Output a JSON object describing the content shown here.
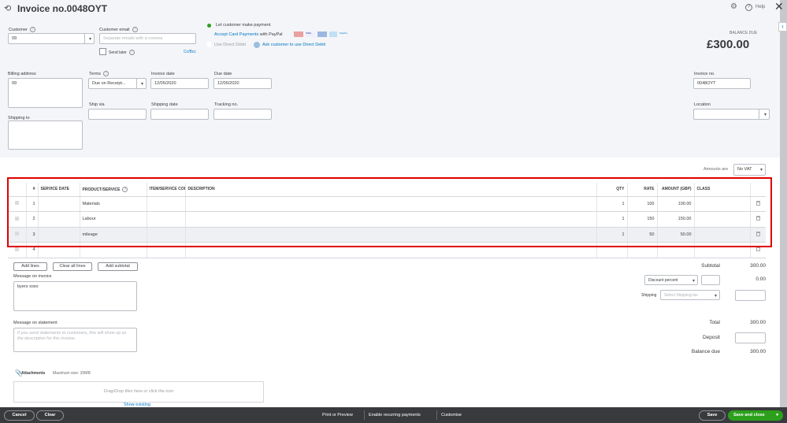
{
  "header": {
    "title": "Invoice no.0048OYT",
    "help": "Help"
  },
  "customer": {
    "label": "Customer",
    "value": "09"
  },
  "email": {
    "label": "Customer email",
    "placeholder": "Separate emails with a comma",
    "send_later": "Send later",
    "cc_bcc": "Cc/Bcc"
  },
  "payment": {
    "let_pay": "Let customer make payment",
    "accept_cards": "Accept Card Payments",
    "with_paypal": " with PayPal",
    "direct_debit": "Use Direct Debit",
    "ask_dd": "Ask customer to use Direct Debit",
    "card_brands": [
      "MC",
      "VISA",
      "MAES",
      "AMEX",
      "PayPal"
    ]
  },
  "balance": {
    "label": "BALANCE DUE",
    "amount": "£300.00"
  },
  "billing": {
    "label": "Billing address",
    "value": "09"
  },
  "shipping_to": {
    "label": "Shipping to"
  },
  "terms": {
    "label": "Terms",
    "value": "Due on Receipt..."
  },
  "invoice_date": {
    "label": "Invoice date",
    "value": "12/05/2020"
  },
  "due_date": {
    "label": "Due date",
    "value": "12/05/2020"
  },
  "ship_via": {
    "label": "Ship via"
  },
  "shipping_date": {
    "label": "Shipping date"
  },
  "tracking": {
    "label": "Tracking no."
  },
  "invoice_no": {
    "label": "Invoice no.",
    "value": "0048OYT"
  },
  "location": {
    "label": "Location"
  },
  "amounts_are": {
    "label": "Amounts are",
    "value": "No VAT"
  },
  "table": {
    "headers": [
      "#",
      "SERVICE DATE",
      "PRODUCT/SERVICE",
      "ITEM/SERVICE CODE",
      "DESCRIPTION",
      "QTY",
      "RATE",
      "AMOUNT (GBP)",
      "CLASS"
    ],
    "rows": [
      {
        "num": "1",
        "product": "Materials",
        "qty": "1",
        "rate": "100",
        "amount": "100.00"
      },
      {
        "num": "2",
        "product": "Labour",
        "qty": "1",
        "rate": "150",
        "amount": "150.00"
      },
      {
        "num": "3",
        "product": "mileage",
        "qty": "1",
        "rate": "50",
        "amount": "50.00"
      },
      {
        "num": "4",
        "product": "",
        "qty": "",
        "rate": "",
        "amount": ""
      }
    ]
  },
  "line_buttons": {
    "add_lines": "Add lines",
    "clear_all": "Clear all lines",
    "add_subtotal": "Add subtotal"
  },
  "msg_invoice": {
    "label": "Message on invoice",
    "value": "byers xoxo"
  },
  "msg_statement": {
    "label": "Message on statement",
    "placeholder": "If you send statements to customers, this will show up as the description for this invoice."
  },
  "attachments": {
    "label": "Attachments",
    "max": "Maximum size: 20MB",
    "drop": "Drag/Drop files here or click the icon",
    "show_existing": "Show existing"
  },
  "totals": {
    "subtotal_label": "Subtotal",
    "subtotal": "300.00",
    "discount_type": "Discount percent",
    "discount": "0.00",
    "shipping_label": "Shipping",
    "shipping_placeholder": "Select Shipping tax",
    "total_label": "Total",
    "total": "300.00",
    "deposit_label": "Deposit",
    "balance_label": "Balance due",
    "balance": "300.00"
  },
  "footer": {
    "cancel": "Cancel",
    "clear": "Clear",
    "print": "Print or Preview",
    "recurring": "Enable recurring payments",
    "customise": "Customise",
    "save": "Save",
    "save_close": "Save and close"
  }
}
